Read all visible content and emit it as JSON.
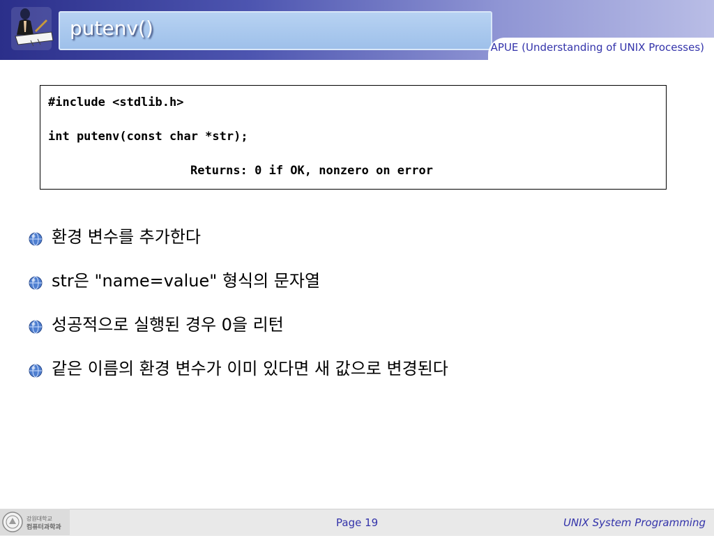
{
  "slide": {
    "title": "putenv()",
    "subtitle": "APUE (Understanding of UNIX Processes)"
  },
  "code": {
    "line1": "#include <stdlib.h>",
    "line2": "int putenv(const char *str);",
    "line3": "Returns: 0 if OK, nonzero on error"
  },
  "bullets": [
    {
      "text": "환경 변수를 추가한다"
    },
    {
      "text": "str은 \"name=value\" 형식의 문자열"
    },
    {
      "text": "성공적으로 실행된 경우 0을 리턴"
    },
    {
      "text": "같은 이름의 환경 변수가 이미 있다면 새 값으로 변경된다"
    }
  ],
  "footer": {
    "logo_text_line1": "강원대학교",
    "logo_text_line2": "컴퓨터과학과",
    "page": "Page 19",
    "course": "UNIX System Programming"
  },
  "icons": {
    "header": "writer-at-desk-icon",
    "bullet": "globe-bullet-icon",
    "footer": "university-seal-icon"
  }
}
